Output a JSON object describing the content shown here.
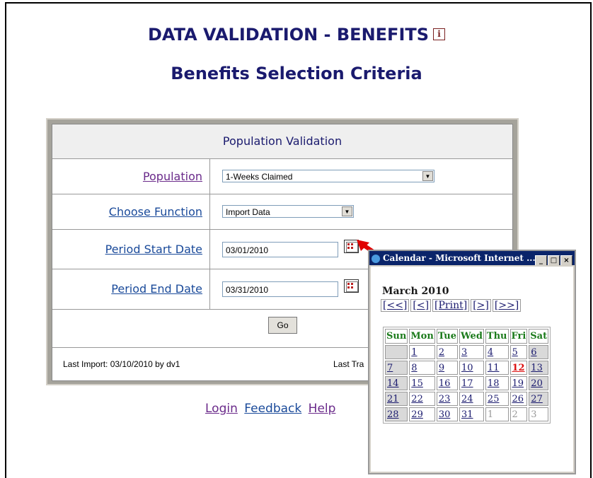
{
  "header": {
    "title": "DATA VALIDATION - BENEFITS",
    "info_icon": "i",
    "subtitle": "Benefits Selection Criteria"
  },
  "panel": {
    "heading": "Population Validation",
    "population": {
      "label": "Population",
      "value": "1-Weeks Claimed"
    },
    "function": {
      "label": "Choose Function",
      "value": "Import Data"
    },
    "start": {
      "label": "Period Start Date",
      "value": "03/01/2010"
    },
    "end": {
      "label": "Period End Date",
      "value": "03/31/2010"
    },
    "go_label": "Go",
    "last_import": "Last Import: 03/10/2010 by dv1",
    "last_tr": "Last Tra"
  },
  "links": {
    "login": "Login",
    "feedback": "Feedback",
    "help": "Help"
  },
  "popup": {
    "window_title": "Calendar - Microsoft Internet ...",
    "month": "March 2010",
    "nav": [
      "[<<]",
      "[<]",
      "[Print]",
      "[>]",
      "[>>]"
    ],
    "weekdays": [
      "Sun",
      "Mon",
      "Tue",
      "Wed",
      "Thu",
      "Fri",
      "Sat"
    ],
    "today": "12",
    "weeks": [
      [
        "",
        "1",
        "2",
        "3",
        "4",
        "5",
        "6"
      ],
      [
        "7",
        "8",
        "9",
        "10",
        "11",
        "12",
        "13"
      ],
      [
        "14",
        "15",
        "16",
        "17",
        "18",
        "19",
        "20"
      ],
      [
        "21",
        "22",
        "23",
        "24",
        "25",
        "26",
        "27"
      ],
      [
        "28",
        "29",
        "30",
        "31",
        "1",
        "2",
        "3"
      ]
    ]
  },
  "colors": {
    "title": "#1a1a6e",
    "today": "#d11111",
    "weekday": "#1a7a1a",
    "titlebar": "#0a246a"
  }
}
